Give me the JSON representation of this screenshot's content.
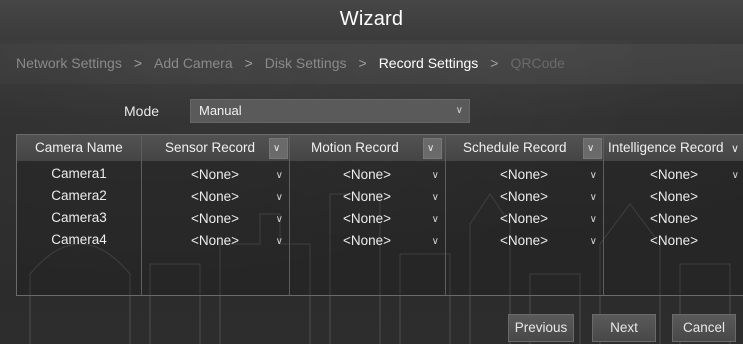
{
  "window": {
    "title": "Wizard"
  },
  "breadcrumb": [
    {
      "label": "Network Settings",
      "state": "done"
    },
    {
      "label": "Add Camera",
      "state": "done"
    },
    {
      "label": "Disk Settings",
      "state": "done"
    },
    {
      "label": "Record Settings",
      "state": "active"
    },
    {
      "label": "QRCode",
      "state": "future"
    }
  ],
  "separator": ">",
  "mode": {
    "label": "Mode",
    "value": "Manual"
  },
  "table": {
    "headers": {
      "camera_name": "Camera Name",
      "sensor": "Sensor Record",
      "motion": "Motion Record",
      "schedule": "Schedule Record",
      "intelligence": "Intelligence Record"
    },
    "rows": [
      {
        "camera": "Camera1",
        "sensor": "<None>",
        "motion": "<None>",
        "schedule": "<None>",
        "intelligence": "<None>"
      },
      {
        "camera": "Camera2",
        "sensor": "<None>",
        "motion": "<None>",
        "schedule": "<None>",
        "intelligence": "<None>"
      },
      {
        "camera": "Camera3",
        "sensor": "<None>",
        "motion": "<None>",
        "schedule": "<None>",
        "intelligence": "<None>"
      },
      {
        "camera": "Camera4",
        "sensor": "<None>",
        "motion": "<None>",
        "schedule": "<None>",
        "intelligence": "<None>"
      }
    ]
  },
  "buttons": {
    "previous": "Previous",
    "next": "Next",
    "cancel": "Cancel"
  },
  "icons": {
    "dropdown": "chevron-down-icon"
  }
}
